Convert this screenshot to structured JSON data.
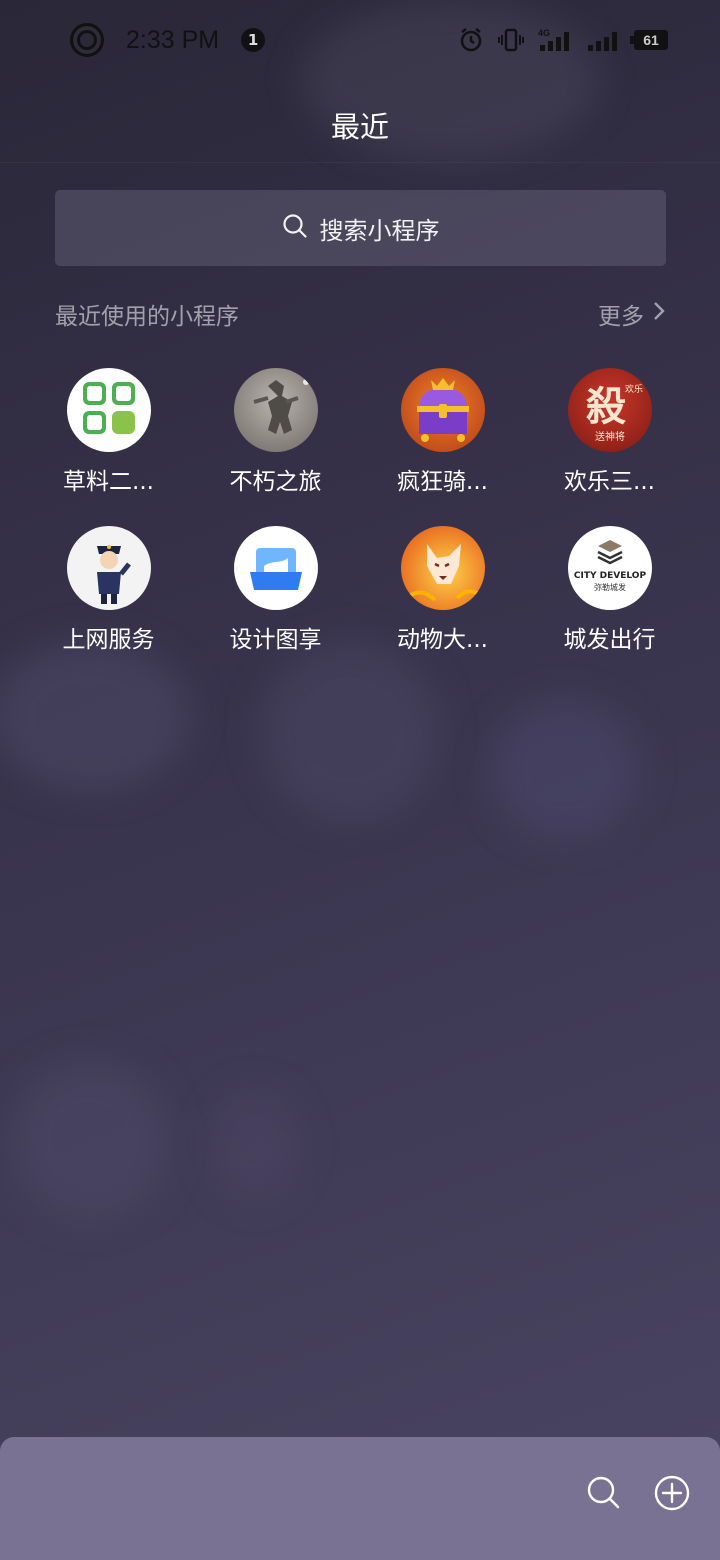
{
  "status_bar": {
    "time": "2:33 PM",
    "notification_count": "1",
    "network": "4G",
    "battery": "61"
  },
  "header": {
    "title": "最近"
  },
  "search": {
    "placeholder": "搜索小程序"
  },
  "section": {
    "title": "最近使用的小程序",
    "more_label": "更多"
  },
  "apps": [
    {
      "name": "草料二...",
      "icon": "grass-qr-icon"
    },
    {
      "name": "不朽之旅",
      "icon": "stone-warrior-icon"
    },
    {
      "name": "疯狂骑...",
      "icon": "treasure-chest-icon"
    },
    {
      "name": "欢乐三...",
      "icon": "sha-card-icon",
      "icon_text": "殺",
      "icon_sub": "送神将",
      "icon_corner": "欢乐"
    },
    {
      "name": "上网服务",
      "icon": "police-officer-icon"
    },
    {
      "name": "设计图享",
      "icon": "picture-frame-icon"
    },
    {
      "name": "动物大...",
      "icon": "fire-fox-icon"
    },
    {
      "name": "城发出行",
      "icon": "city-develop-icon",
      "icon_text": "CITY DEVELOP",
      "icon_sub": "弥勒城发"
    }
  ],
  "colors": {
    "background": "#363149",
    "bottom_bar": "#797293",
    "sha_red": "#b72a1e",
    "design_blue": "#2f7cf0"
  }
}
